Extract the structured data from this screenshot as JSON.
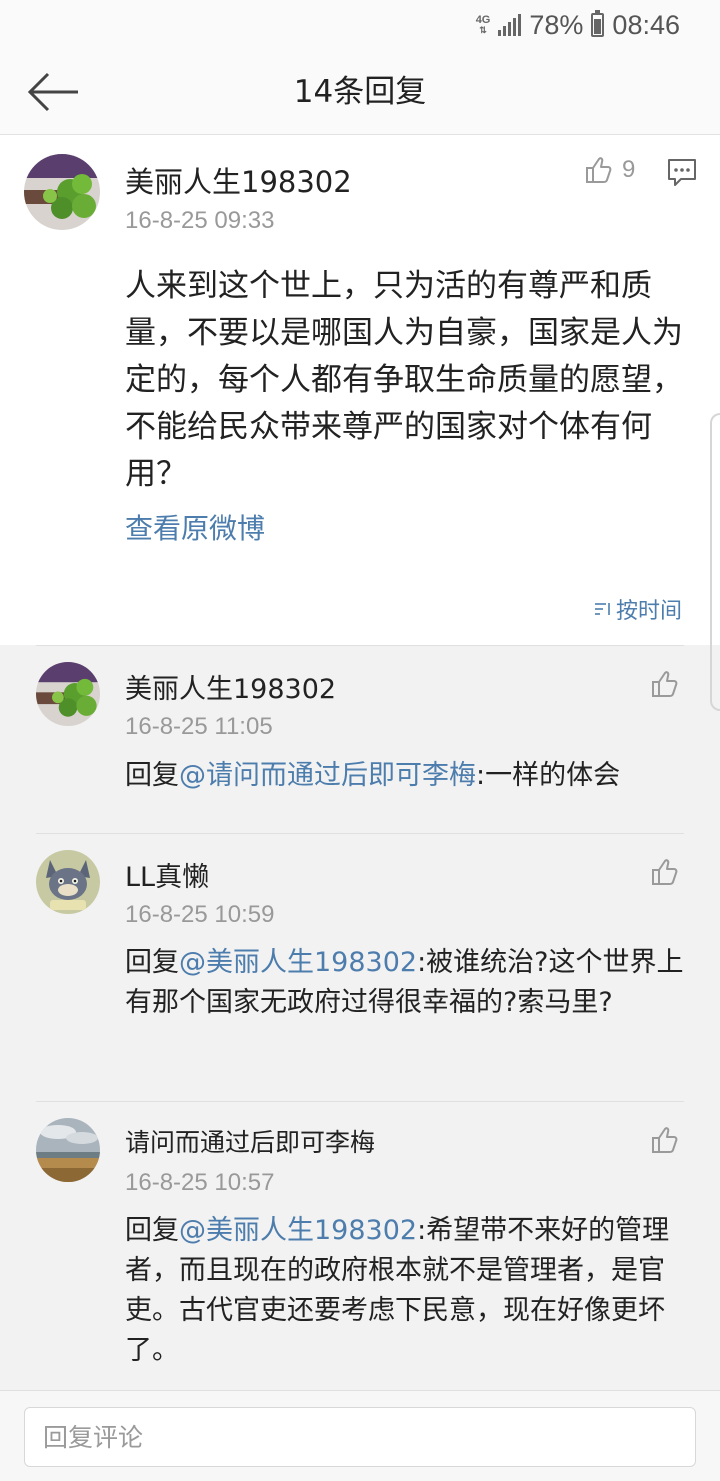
{
  "status_bar": {
    "network": "4G",
    "battery": "78%",
    "battery_level": 0.78,
    "time": "08:46"
  },
  "header": {
    "title": "14条回复",
    "back_icon": "arrow-left-icon"
  },
  "post": {
    "username": "美丽人生198302",
    "time": "16-8-25 09:33",
    "likes": "9",
    "body": "人来到这个世上，只为活的有尊严和质量，不要以是哪国人为自豪，国家是人为定的，每个人都有争取生命质量的愿望，不能给民众带来尊严的国家对个体有何用？",
    "view_original": "查看原微博",
    "sort_label": "按时间"
  },
  "replies": [
    {
      "username": "美丽人生198302",
      "time": "16-8-25 11:05",
      "prefix": "回复",
      "mention": "@请问而通过后即可李梅",
      "text": ":一样的体会"
    },
    {
      "username": "LL真懒",
      "time": "16-8-25 10:59",
      "prefix": "回复",
      "mention": "@美丽人生198302",
      "text": ":被谁统治?这个世界上有那个国家无政府过得很幸福的?索马里?"
    },
    {
      "username": "请问而通过后即可李梅",
      "time": "16-8-25 10:57",
      "prefix": "回复",
      "mention": "@美丽人生198302",
      "text": ":希望带不来好的管理者，而且现在的政府根本就不是管理者，是官吏。古代官吏还要考虑下民意，现在好像更坏了。"
    }
  ],
  "composer": {
    "placeholder": "回复评论"
  },
  "colors": {
    "link": "#4d7dad",
    "background": "#f2f2f2",
    "text": "#222222",
    "muted": "#999999"
  }
}
